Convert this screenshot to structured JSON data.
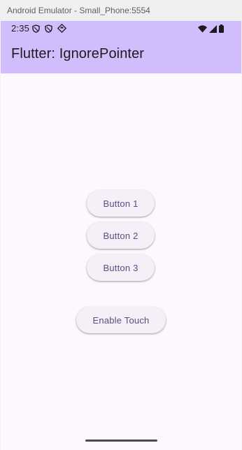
{
  "window": {
    "title": "Android Emulator - Small_Phone:5554"
  },
  "status_bar": {
    "time": "2:35",
    "left_icons": [
      "shield-icon",
      "shield-icon",
      "android-debug-icon"
    ],
    "right_icons": [
      "wifi-icon",
      "cell-signal-icon",
      "battery-icon"
    ]
  },
  "app_bar": {
    "title": "Flutter: IgnorePointer",
    "color": "#d1bdfb"
  },
  "buttons": [
    {
      "label": "Button 1"
    },
    {
      "label": "Button 2"
    },
    {
      "label": "Button 3"
    }
  ],
  "toggle_button": {
    "label": "Enable Touch"
  },
  "colors": {
    "background": "#fdf7ff",
    "button_bg": "#f5eff7",
    "button_text": "#5b4b86"
  }
}
